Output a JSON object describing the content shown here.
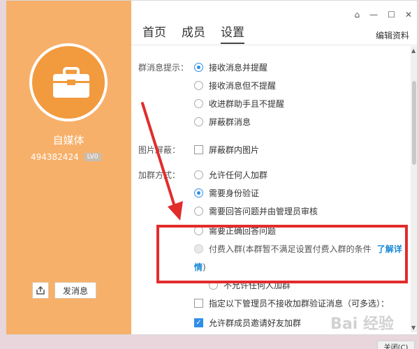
{
  "header": {
    "tabs": [
      "首页",
      "成员",
      "设置"
    ],
    "active_tab": "设置",
    "edit_link": "编辑资料"
  },
  "profile": {
    "name": "自媒体",
    "id": "494382424",
    "level": "LV0",
    "send_button": "发消息"
  },
  "settings": {
    "message_label": "群消息提示：",
    "message_options": [
      "接收消息并提醒",
      "接收消息但不提醒",
      "收进群助手且不提醒",
      "屏蔽群消息"
    ],
    "image_label": "图片屏蔽：",
    "image_option": "屏蔽群内图片",
    "join_label": "加群方式：",
    "join_options": [
      "允许任何人加群",
      "需要身份验证",
      "需要回答问题并由管理员审核",
      "需要正确回答问题"
    ],
    "paid_text_1": "付费入群(本群暂不满足设置付费入群的条件 ",
    "paid_link_1": "了解详",
    "paid_link_2": "情",
    "paid_text_2": ")",
    "no_join": "不允许任何人加群",
    "admin_check": "指定以下管理员不接收加群验证消息（可多选）：",
    "invite_check": "允许群成员邀请好友加群"
  },
  "footer": {
    "close_button": "关闭(C)"
  },
  "watermark": "Bai 经验"
}
